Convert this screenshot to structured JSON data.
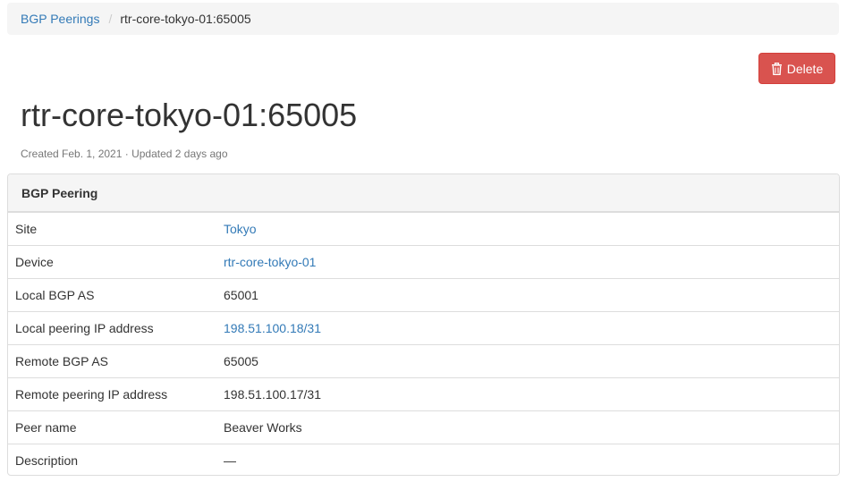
{
  "breadcrumb": {
    "parent": "BGP Peerings",
    "separator": "/",
    "current": "rtr-core-tokyo-01:65005"
  },
  "actions": {
    "delete_label": "Delete"
  },
  "page": {
    "title": "rtr-core-tokyo-01:65005",
    "meta": "Created Feb. 1, 2021 · Updated 2 days ago"
  },
  "panel": {
    "heading": "BGP Peering",
    "rows": [
      {
        "label": "Site",
        "value": "Tokyo"
      },
      {
        "label": "Device",
        "value": "rtr-core-tokyo-01"
      },
      {
        "label": "Local BGP AS",
        "value": "65001"
      },
      {
        "label": "Local peering IP address",
        "value": "198.51.100.18/31"
      },
      {
        "label": "Remote BGP AS",
        "value": "65005"
      },
      {
        "label": "Remote peering IP address",
        "value": "198.51.100.17/31"
      },
      {
        "label": "Peer name",
        "value": "Beaver Works"
      },
      {
        "label": "Description",
        "value": "—"
      }
    ]
  },
  "icons": {
    "delete": "trash-icon"
  },
  "colors": {
    "link": "#337ab7",
    "danger": "#d9534f"
  }
}
